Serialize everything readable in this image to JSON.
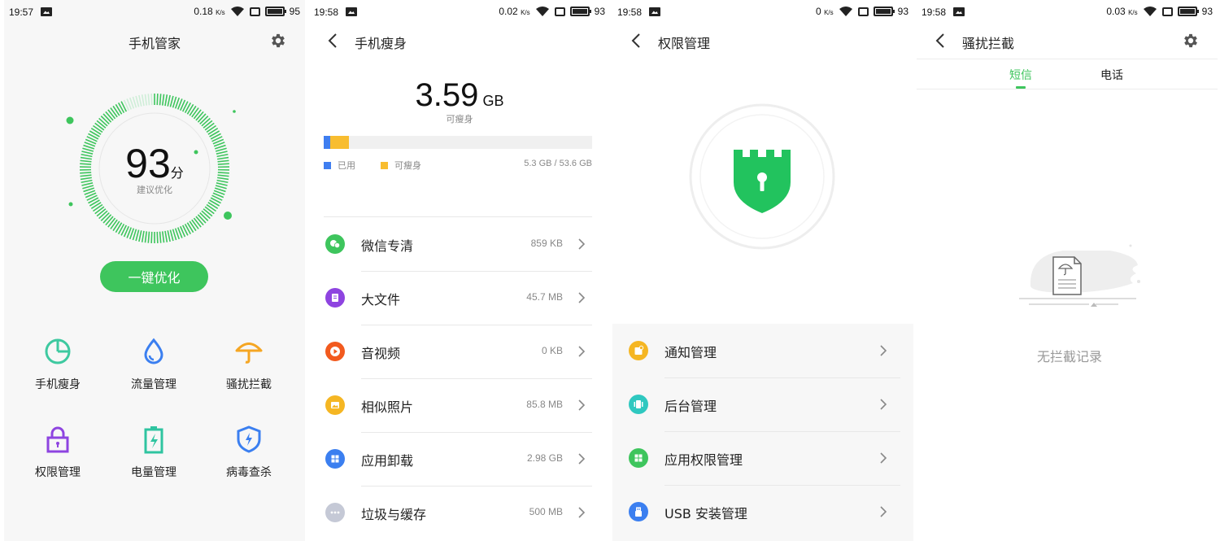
{
  "screens": {
    "home": {
      "status": {
        "time": "19:57",
        "speed": "0.18",
        "speed_unit": "K/s",
        "battery": "95"
      },
      "title": "手机管家",
      "score": {
        "value": "93",
        "unit": "分",
        "subtitle": "建议优化",
        "level": 0.93
      },
      "optimize_label": "一键优化",
      "tools": [
        {
          "label": "手机瘦身",
          "icon": "pie-chart-icon",
          "color": "#3ec9a0"
        },
        {
          "label": "流量管理",
          "icon": "water-drop-icon",
          "color": "#3b7ff0"
        },
        {
          "label": "骚扰拦截",
          "icon": "umbrella-icon",
          "color": "#f5a623"
        },
        {
          "label": "权限管理",
          "icon": "lock-icon",
          "color": "#8e44e0"
        },
        {
          "label": "电量管理",
          "icon": "battery-icon",
          "color": "#2fc4a0"
        },
        {
          "label": "病毒查杀",
          "icon": "shield-bolt-icon",
          "color": "#3b7ff0"
        }
      ]
    },
    "slim": {
      "status": {
        "time": "19:58",
        "speed": "0.02",
        "speed_unit": "K/s",
        "battery": "93"
      },
      "title": "手机瘦身",
      "size": {
        "value": "3.59",
        "unit": "GB",
        "label": "可瘦身"
      },
      "usage": {
        "used_fraction": 0.025,
        "slimmable_fraction": 0.068
      },
      "legend": {
        "used": "已用",
        "slimmable": "可瘦身",
        "total": "5.3 GB / 53.6 GB"
      },
      "items": [
        {
          "label": "微信专清",
          "size": "859 KB",
          "icon": "wechat-icon",
          "color": "#3ec55d"
        },
        {
          "label": "大文件",
          "size": "45.7 MB",
          "icon": "file-icon",
          "color": "#8e44e0"
        },
        {
          "label": "音视频",
          "size": "0 KB",
          "icon": "play-icon",
          "color": "#f25a1e"
        },
        {
          "label": "相似照片",
          "size": "85.8 MB",
          "icon": "photo-icon",
          "color": "#f5b623"
        },
        {
          "label": "应用卸载",
          "size": "2.98 GB",
          "icon": "apps-icon",
          "color": "#3b7ff0"
        },
        {
          "label": "垃圾与缓存",
          "size": "500 MB",
          "icon": "more-icon",
          "color": "#c5c9d6"
        }
      ],
      "colors": {
        "used": "#3f7ef0",
        "slimmable": "#f8bd30"
      }
    },
    "permission": {
      "status": {
        "time": "19:58",
        "speed": "0",
        "speed_unit": "K/s",
        "battery": "93"
      },
      "title": "权限管理",
      "items": [
        {
          "label": "通知管理",
          "icon": "notification-icon",
          "color": "#f5b623"
        },
        {
          "label": "后台管理",
          "icon": "background-icon",
          "color": "#2fc8c0"
        },
        {
          "label": "应用权限管理",
          "icon": "app-permission-icon",
          "color": "#3ec55d"
        },
        {
          "label": "USB 安装管理",
          "icon": "usb-icon",
          "color": "#3b7ff0"
        }
      ]
    },
    "harass": {
      "status": {
        "time": "19:58",
        "speed": "0.03",
        "speed_unit": "K/s",
        "battery": "93"
      },
      "title": "骚扰拦截",
      "tabs": [
        "短信",
        "电话"
      ],
      "empty_text": "无拦截记录"
    }
  },
  "colors": {
    "accent": "#3ec55d"
  }
}
